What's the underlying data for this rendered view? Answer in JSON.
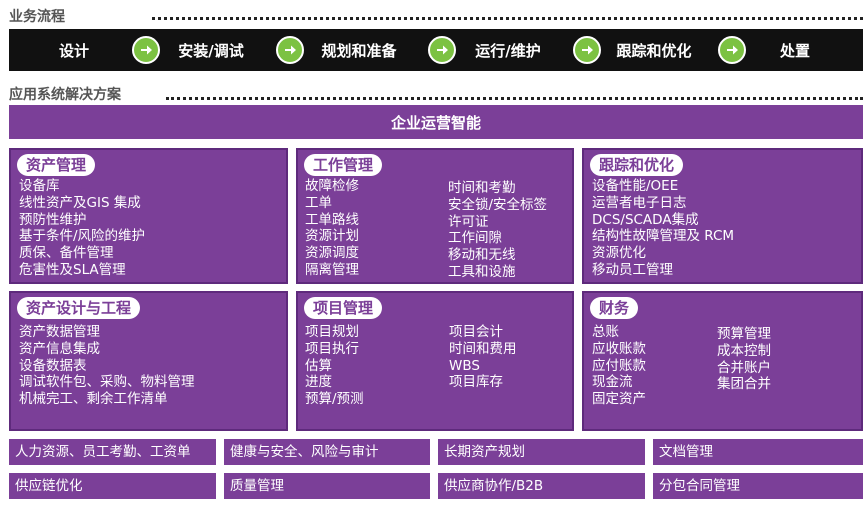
{
  "header": {
    "process_title": "业务流程",
    "solution_title": "应用系统解决方案"
  },
  "process_steps": [
    "设计",
    "安装/调试",
    "规划和准备",
    "运行/维护",
    "跟踪和优化",
    "处置"
  ],
  "enterprise_bar": "企业运营智能",
  "panels": {
    "asset_management": {
      "title": "资产管理",
      "col1": [
        "设备库",
        "线性资产及GIS 集成",
        "预防性维护",
        "基于条件/风险的维护",
        "质保、备件管理",
        "危害性及SLA管理"
      ]
    },
    "work_management": {
      "title": "工作管理",
      "col1": [
        "故障检修",
        "工单",
        "工单路线",
        "资源计划",
        "资源调度",
        "隔离管理"
      ],
      "col2": [
        "时间和考勤",
        "安全锁/安全标签",
        "许可证",
        "工作间隙",
        "移动和无线",
        "工具和设施"
      ]
    },
    "tracking_optimization": {
      "title": "跟踪和优化",
      "col1": [
        "设备性能/OEE",
        "运营者电子日志",
        "DCS/SCADA集成",
        "结构性故障管理及 RCM",
        "资源优化",
        "移动员工管理"
      ]
    },
    "asset_design": {
      "title": "资产设计与工程",
      "col1": [
        "资产数据管理",
        "资产信息集成",
        "设备数据表",
        "调试软件包、采购、物料管理",
        "机械完工、剩余工作清单"
      ]
    },
    "project_management": {
      "title": "项目管理",
      "col1": [
        "项目规划",
        "项目执行",
        "估算",
        "进度",
        "预算/预测"
      ],
      "col2": [
        "项目会计",
        "时间和费用",
        "WBS",
        "项目库存"
      ]
    },
    "finance": {
      "title": "财务",
      "col1": [
        "总账",
        "应收账款",
        "应付账款",
        "现金流",
        "固定资产"
      ],
      "col2": [
        "预算管理",
        "成本控制",
        "合并账户",
        "集团合并"
      ]
    }
  },
  "bottom_row1": [
    "人力资源、员工考勤、工资单",
    "健康与安全、风险与审计",
    "长期资产规划",
    "文档管理"
  ],
  "bottom_row2": [
    "供应链优化",
    "质量管理",
    "供应商协作/B2B",
    "分包合同管理"
  ],
  "colors": {
    "purple": "#7b3f98",
    "arrow_green": "#7cc242",
    "flow_background": "#111111"
  }
}
